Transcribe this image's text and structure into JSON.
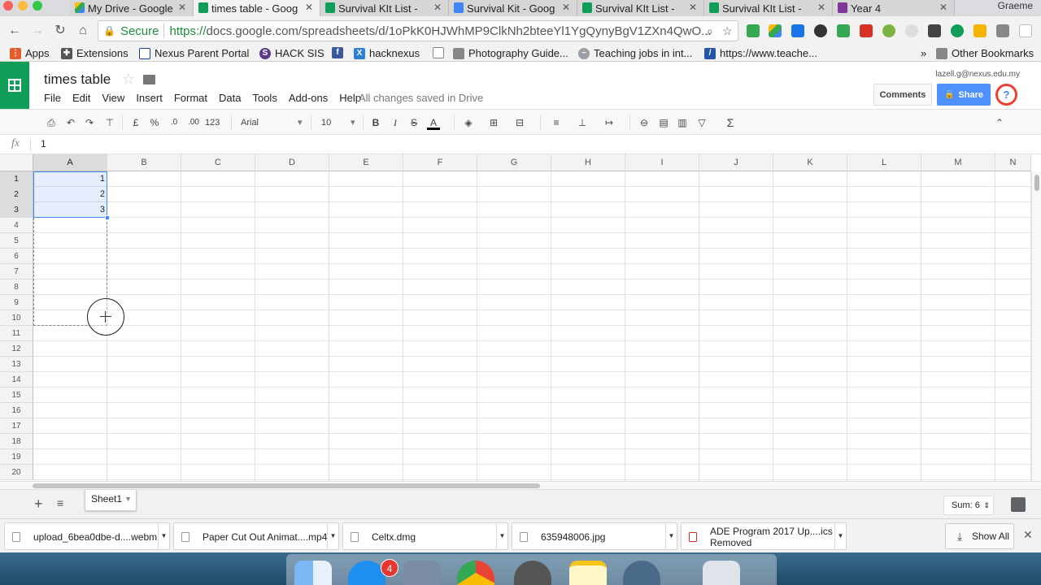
{
  "browser": {
    "tabs": [
      {
        "title": "My Drive - Google"
      },
      {
        "title": "times table - Goog"
      },
      {
        "title": "Survival KIt List -"
      },
      {
        "title": "Survival Kit - Goog"
      },
      {
        "title": "Survival KIt List -"
      },
      {
        "title": "Survival KIt List -"
      },
      {
        "title": "Year 4"
      }
    ],
    "profile_name": "Graeme",
    "secure_label": "Secure",
    "url_scheme": "https://",
    "url_rest": "docs.google.com/spreadsheets/d/1oPkK0HJWhMP9ClkNh2bteeYl1YgQynyBgV1ZXn4QwO...",
    "bookmarks": [
      {
        "label": "Apps",
        "icon": "apps-grid-icon"
      },
      {
        "label": "Extensions",
        "icon": "puzzle-icon"
      },
      {
        "label": "Nexus Parent Portal",
        "icon": "page-icon"
      },
      {
        "label": "HACK SIS",
        "icon": "s-circle-icon"
      },
      {
        "label": "",
        "icon": "facebook-icon"
      },
      {
        "label": "hacknexus",
        "icon": "x-box-icon"
      },
      {
        "label": "",
        "icon": "blank-page-icon"
      },
      {
        "label": "Photography Guide...",
        "icon": "photo-icon"
      },
      {
        "label": "Teaching jobs in int...",
        "icon": "swirl-icon"
      },
      {
        "label": "https://www.teache...",
        "icon": "link-icon"
      }
    ],
    "bookmarks_overflow": "»",
    "other_bookmarks": "Other Bookmarks"
  },
  "sheets": {
    "title": "times table",
    "menu": [
      "File",
      "Edit",
      "View",
      "Insert",
      "Format",
      "Data",
      "Tools",
      "Add-ons",
      "Help"
    ],
    "save_status": "All changes saved in Drive",
    "account": "lazell.g@nexus.edu.my",
    "comments_label": "Comments",
    "share_label": "Share",
    "avatar_label": "?",
    "toolbar": {
      "currency": "£",
      "percent": "%",
      "dec_decrease": ".0",
      "dec_increase": ".00",
      "more_formats": "123",
      "font": "Arial",
      "font_size": "10",
      "bold": "B",
      "italic": "I",
      "strike": "S",
      "text_color": "A",
      "sum": "Σ"
    },
    "fx_label": "fx",
    "formula_value": "1",
    "columns": [
      "A",
      "B",
      "C",
      "D",
      "E",
      "F",
      "G",
      "H",
      "I",
      "J",
      "K",
      "L",
      "M",
      "N"
    ],
    "rows": [
      "1",
      "2",
      "3",
      "4",
      "5",
      "6",
      "7",
      "8",
      "9",
      "10",
      "11",
      "12",
      "13",
      "14",
      "15",
      "16",
      "17",
      "18",
      "19",
      "20"
    ],
    "cells": {
      "A1": "1",
      "A2": "2",
      "A3": "3"
    },
    "add_sheet": "+",
    "all_sheets": "≡",
    "sheet_tab": "Sheet1",
    "sum_label": "Sum: 6"
  },
  "downloads": {
    "items": [
      {
        "name": "upload_6bea0dbe-d....webm"
      },
      {
        "name": "Paper Cut Out Animat....mp4"
      },
      {
        "name": "Celtx.dmg"
      },
      {
        "name": "635948006.jpg"
      },
      {
        "name": "ADE Program 2017 Up....ics",
        "status": "Removed"
      }
    ],
    "show_all": "Show All",
    "close": "✕"
  },
  "dock": {
    "badge": "4"
  },
  "colors": {
    "sheets_green": "#0f9d58",
    "share_blue": "#4d90fe",
    "selection_blue": "#4285f4",
    "secure_green": "#1e8e3e"
  }
}
